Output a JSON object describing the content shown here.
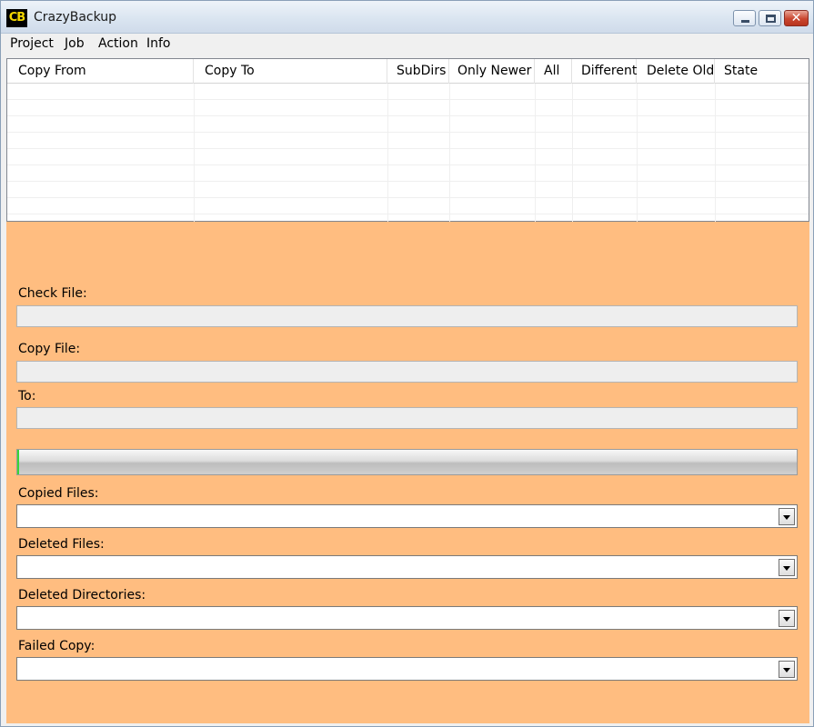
{
  "window": {
    "icon_text": "CB",
    "title": "CrazyBackup"
  },
  "menu": [
    "Project",
    "Job",
    "Action",
    "Info"
  ],
  "grid": {
    "columns": [
      "Copy From",
      "Copy To",
      "SubDirs",
      "Only Newer",
      "All",
      "Different",
      "Delete Old",
      "State"
    ],
    "rows": []
  },
  "panel": {
    "check_file_label": "Check File:",
    "check_file_value": "",
    "copy_file_label": "Copy File:",
    "copy_file_value": "",
    "to_label": "To:",
    "to_value": "",
    "progress_fraction": 0.0,
    "copied_files_label": "Copied Files:",
    "copied_files_value": "",
    "deleted_files_label": "Deleted Files:",
    "deleted_files_value": "",
    "deleted_dirs_label": "Deleted Directories:",
    "deleted_dirs_value": "",
    "failed_copy_label": "Failed Copy:",
    "failed_copy_value": ""
  },
  "colors": {
    "panel_background": "#ffbd80",
    "progress_fill": "#37d637"
  },
  "icons": [
    "minimize-icon",
    "maximize-icon",
    "close-icon",
    "chevron-down-icon"
  ]
}
